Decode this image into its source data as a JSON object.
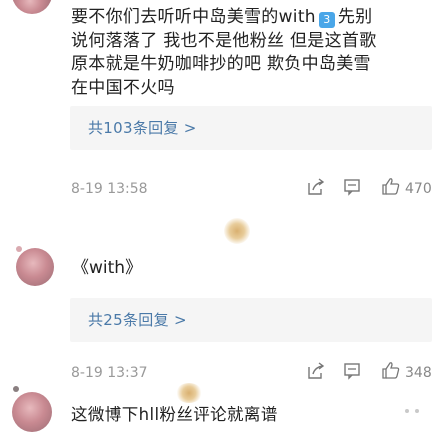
{
  "comment1": {
    "text_line1_pre": "要不你们去听听中岛美雪的with",
    "badge": "3",
    "text_line1_post": "先别",
    "text_line2": "说何落落了 我也不是他粉丝 但是这首歌",
    "text_line3": "原本就是牛奶咖啡抄的吧 欺负中岛美雪",
    "text_line4": "在中国不火吗",
    "reply_link": "共103条回复 >",
    "date": "8-19 13:58",
    "likes": "470"
  },
  "comment2": {
    "text": "《with》",
    "reply_link": "共25条回复 >",
    "date": "8-19 13:37",
    "likes": "348"
  },
  "comment3": {
    "text": "这微博下hll粉丝评论就离谱"
  },
  "icons": {
    "share": "share-icon",
    "comment": "comment-icon",
    "like": "thumbs-up-icon"
  }
}
